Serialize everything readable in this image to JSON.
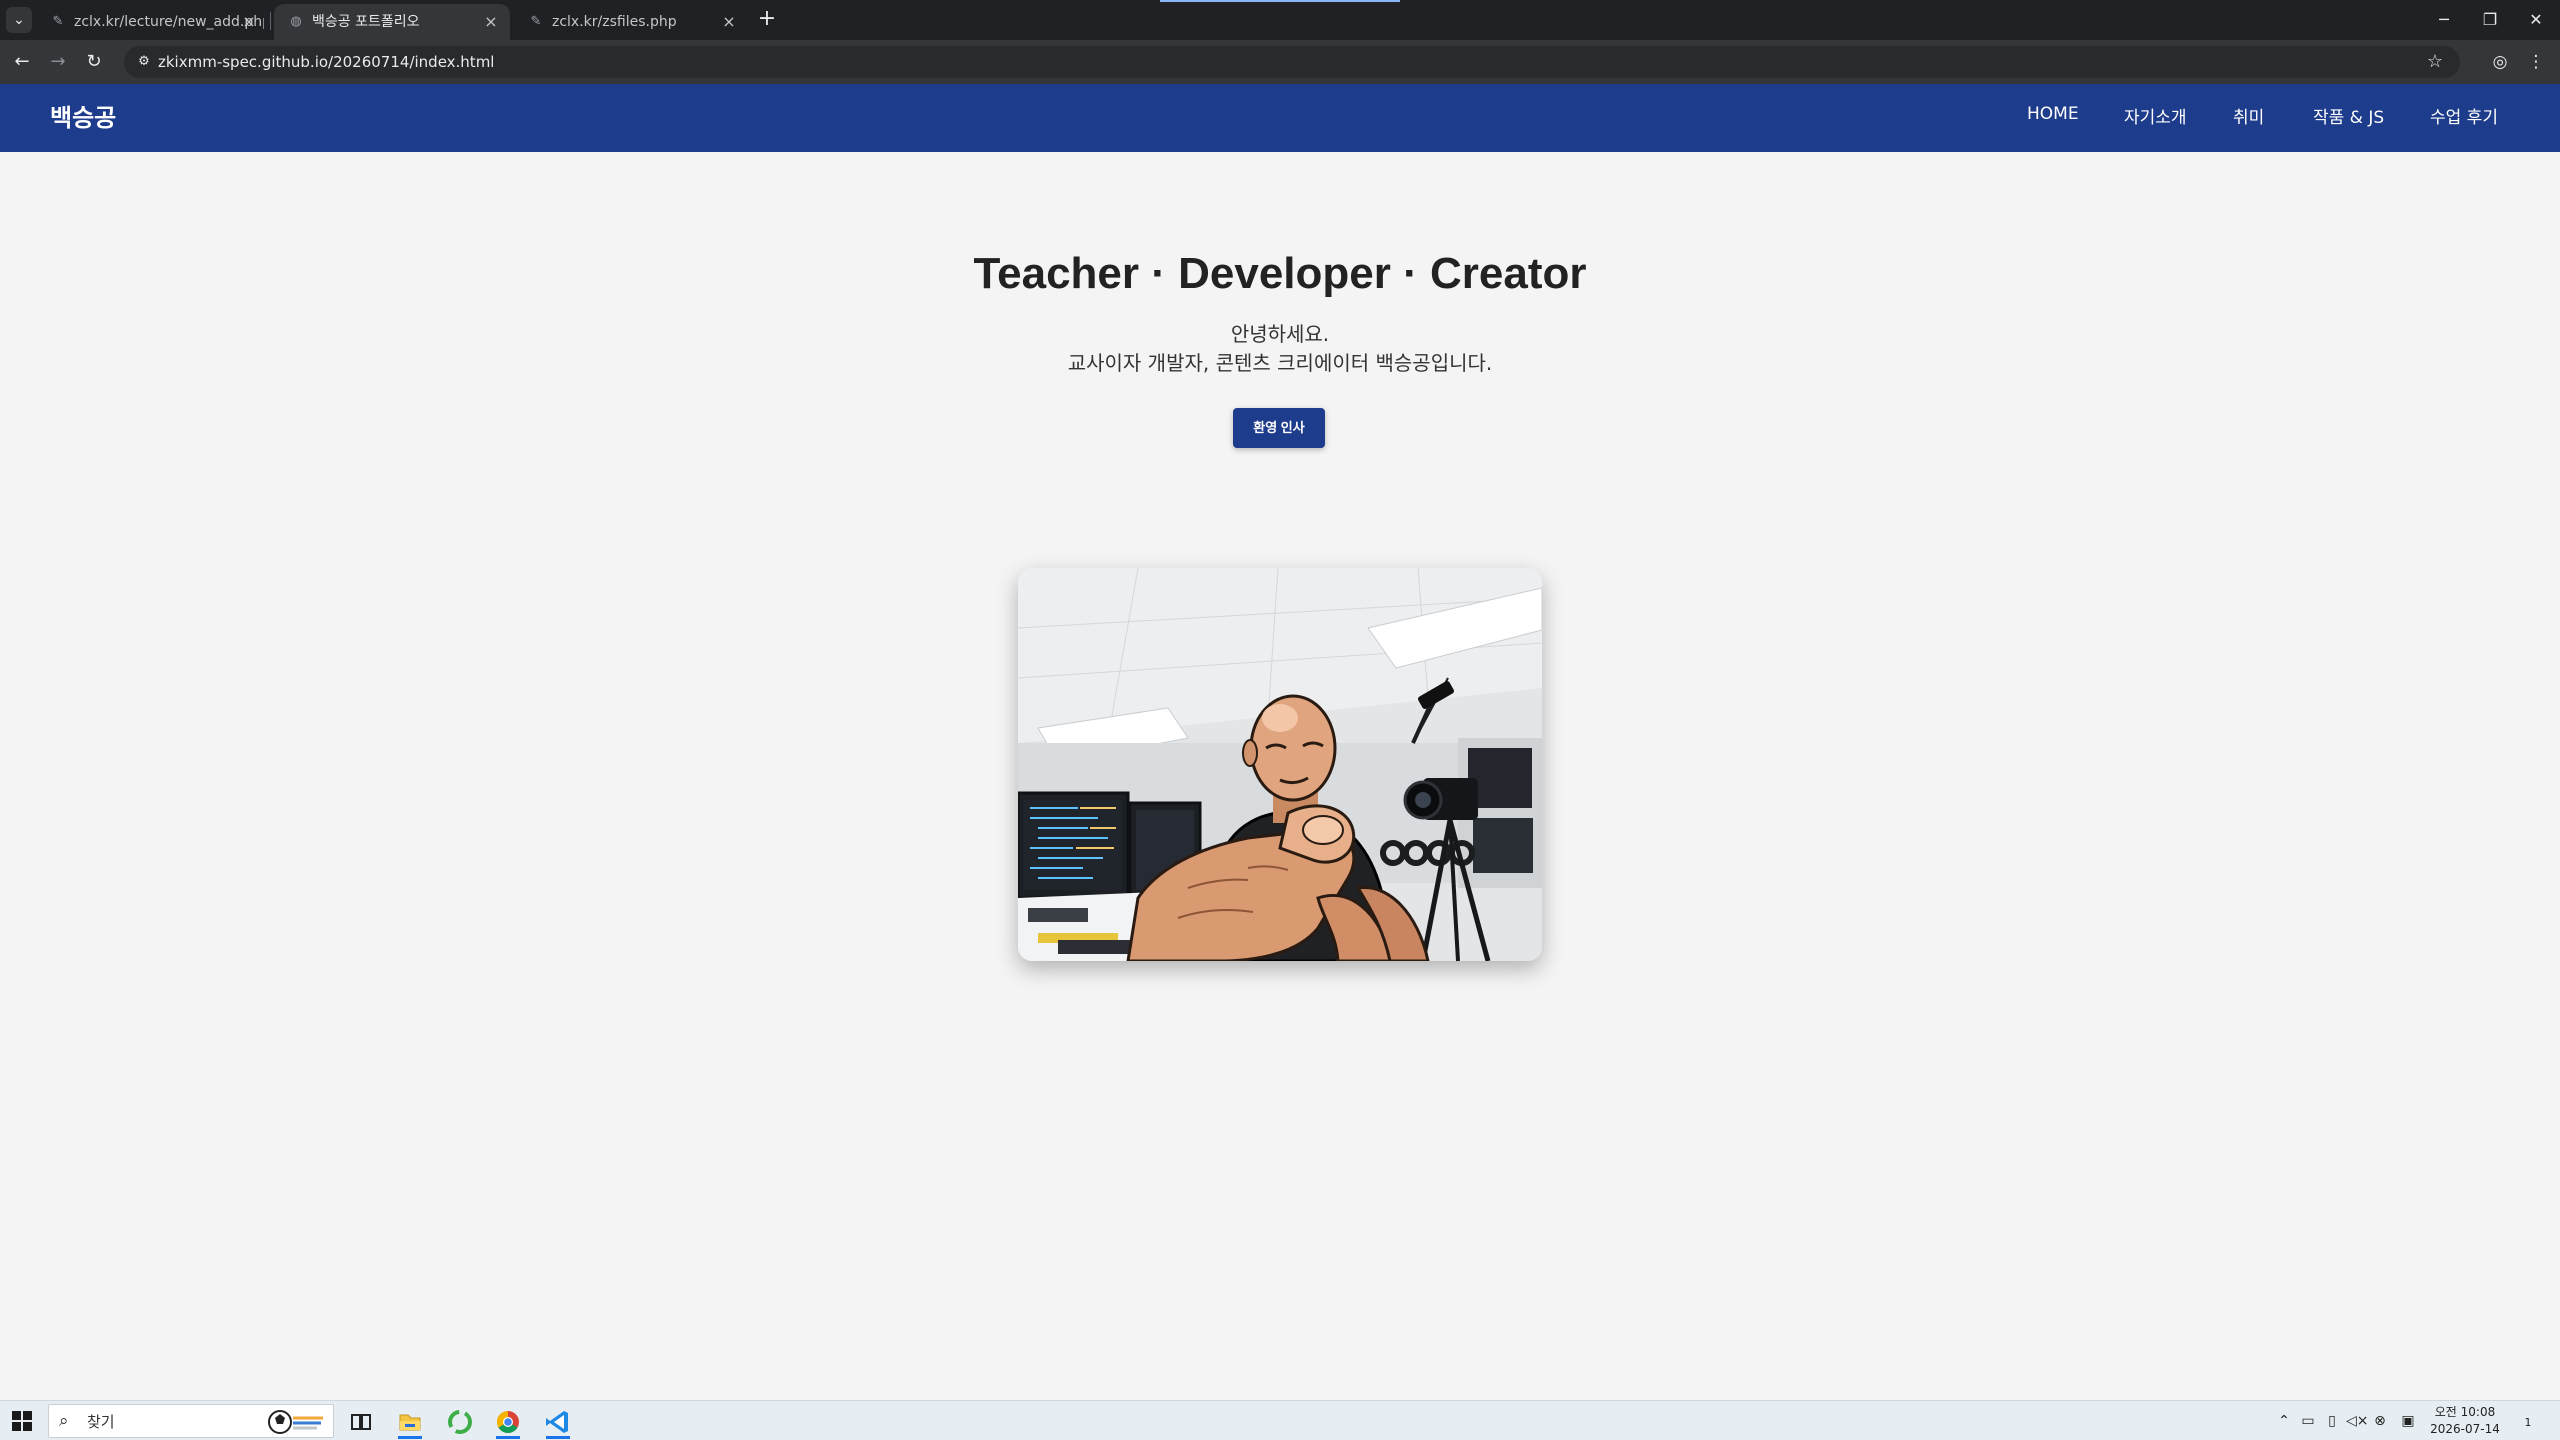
{
  "browser": {
    "tabs": [
      {
        "title": "zclx.kr/lecture/new_add.php?re",
        "active": false
      },
      {
        "title": "백승공 포트폴리오",
        "active": true
      },
      {
        "title": "zclx.kr/zsfiles.php",
        "active": false
      }
    ],
    "url": "zkixmm-spec.github.io/20260714/index.html"
  },
  "site": {
    "logo": "백승공",
    "nav": [
      "HOME",
      "자기소개",
      "취미",
      "작품 & JS",
      "수업 후기"
    ],
    "hero": {
      "title": "Teacher · Developer · Creator",
      "line1": "안녕하세요.",
      "line2": "교사이자 개발자, 콘텐츠 크리에이터 백승공입니다.",
      "button": "환영 인사"
    }
  },
  "taskbar": {
    "search_placeholder": "찾기",
    "clock_line1": "오전 10:08",
    "clock_line2": "2026-07-14",
    "notification_count": "1"
  },
  "colors": {
    "header_bg": "#1e3c8c",
    "page_bg": "#f4f4f4",
    "button_bg": "#1e3c8c"
  }
}
